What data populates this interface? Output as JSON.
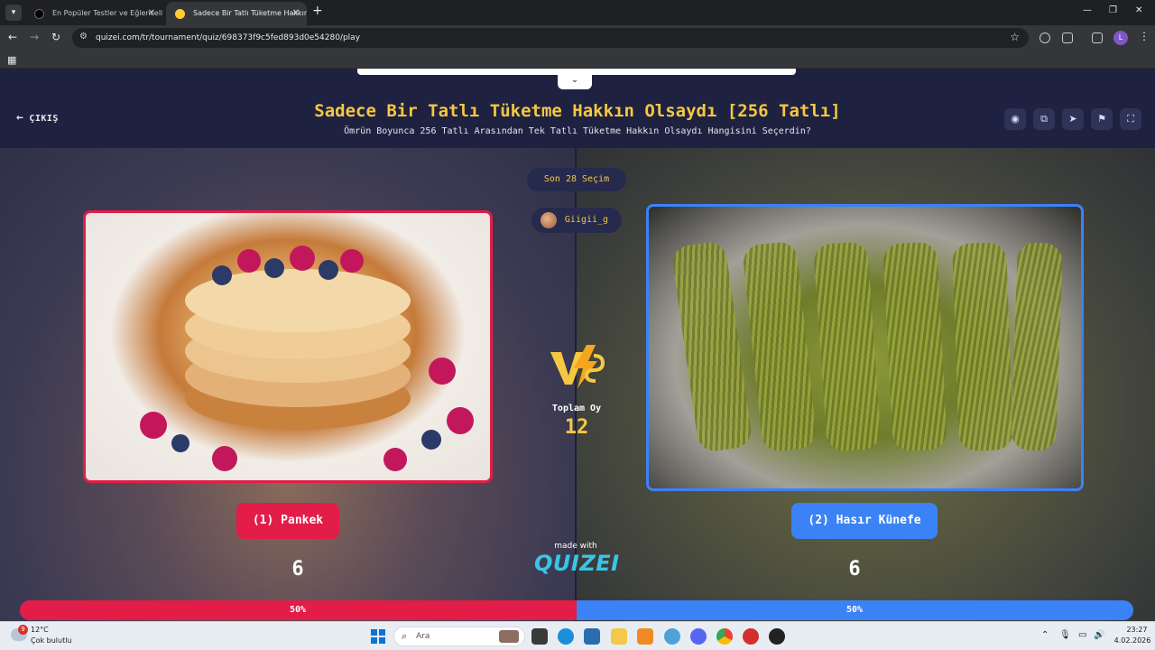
{
  "browser": {
    "tabs": [
      {
        "title": "En Popüler Testler ve Eğlenceli T",
        "active": false
      },
      {
        "title": "Sadece Bir Tatlı Tüketme Hakkın",
        "active": true
      }
    ],
    "url": "quizei.com/tr/tournament/quiz/698373f9c5fed893d0e54280/play",
    "profile_initial": "L"
  },
  "header": {
    "exit_label": "ÇIKIŞ",
    "title": "Sadece Bir Tatlı Tüketme Hakkın Olsaydı [256 Tatlı]",
    "subtitle": "Ömrün Boyunca 256 Tatlı Arasından Tek Tatlı Tüketme Hakkın Olsaydı Hangisini Seçerdin?",
    "icons": [
      "eye-icon",
      "share-icon",
      "send-icon",
      "flag-icon",
      "fullscreen-icon"
    ]
  },
  "center": {
    "recent_label": "Son 28 Seçim",
    "username": "Giigii_g",
    "total_label": "Toplam Oy",
    "total_value": "12",
    "made_with": "made with",
    "brand": "QUIZEI"
  },
  "left": {
    "choice_label": "(1) Pankek",
    "votes": "6",
    "percent_label": "50%",
    "percent": 0.5,
    "color": "#e11d48"
  },
  "right": {
    "choice_label": "(2) Hasır Künefe",
    "votes": "6",
    "percent_label": "50%",
    "percent": 0.5,
    "color": "#3b82f6"
  },
  "taskbar": {
    "weather_badge": "9",
    "temperature": "12°C",
    "condition": "Çok bulutlu",
    "search_placeholder": "Ara",
    "time": "23:27",
    "date": "4.02.2026"
  }
}
